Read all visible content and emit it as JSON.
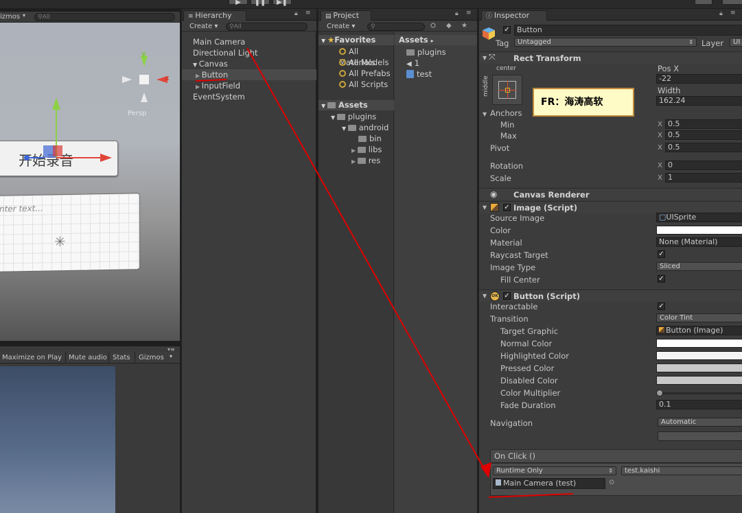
{
  "scene": {
    "gizmos_label": "izmos",
    "search_placeholder": "All",
    "axis_y": "y",
    "axis_x": "x",
    "persp_label": "Persp",
    "button_text": "开始录音",
    "input_placeholder": "nter text..."
  },
  "game": {
    "toolbar": [
      "Maximize on Play",
      "Mute audio",
      "Stats",
      "Gizmos"
    ]
  },
  "hierarchy": {
    "tab": "Hierarchy",
    "create": "Create",
    "search_placeholder": "All",
    "items": [
      "Main Camera",
      "Directional Light",
      "Canvas",
      "Button",
      "InputField",
      "EventSystem"
    ]
  },
  "project": {
    "tab": "Project",
    "create": "Create",
    "favorites_title": "Favorites",
    "favorites": [
      "All Materials",
      "All Models",
      "All Prefabs",
      "All Scripts"
    ],
    "assets_title": "Assets",
    "tree": [
      "plugins",
      "android",
      "bin",
      "libs",
      "res"
    ],
    "breadcrumb": "Assets",
    "assets_items": [
      "plugins",
      "1",
      "test"
    ]
  },
  "inspector": {
    "tab": "Inspector",
    "object_name": "Button",
    "object_active": true,
    "tag_label": "Tag",
    "tag_value": "Untagged",
    "layer_label": "Layer",
    "layer_value": "UI",
    "rect": {
      "title": "Rect Transform",
      "anchor_h": "center",
      "anchor_v": "middle",
      "posx_label": "Pos X",
      "posx_value": "-22",
      "width_label": "Width",
      "width_value": "162.24",
      "anchors_label": "Anchors",
      "min_label": "Min",
      "min_x": "0.5",
      "max_label": "Max",
      "max_x": "0.5",
      "pivot_label": "Pivot",
      "pivot_x": "0.5",
      "rotation_label": "Rotation",
      "rotation_x": "0",
      "scale_label": "Scale",
      "scale_x": "1",
      "x_axis": "X"
    },
    "canvas_renderer": "Canvas Renderer",
    "image": {
      "title": "Image (Script)",
      "enabled": true,
      "source_image_label": "Source Image",
      "source_image_value": "UISprite",
      "color_label": "Color",
      "material_label": "Material",
      "material_value": "None (Material)",
      "raycast_label": "Raycast Target",
      "raycast_checked": true,
      "image_type_label": "Image Type",
      "image_type_value": "Sliced",
      "fill_center_label": "Fill Center",
      "fill_center_checked": true
    },
    "button": {
      "title": "Button (Script)",
      "enabled": true,
      "interactable_label": "Interactable",
      "interactable_checked": true,
      "transition_label": "Transition",
      "transition_value": "Color Tint",
      "target_graphic_label": "Target Graphic",
      "target_graphic_value": "Button (Image)",
      "normal_label": "Normal Color",
      "highlighted_label": "Highlighted Color",
      "pressed_label": "Pressed Color",
      "disabled_label": "Disabled Color",
      "multiplier_label": "Color Multiplier",
      "multiplier_value": 1,
      "fade_label": "Fade Duration",
      "fade_value": "0.1",
      "navigation_label": "Navigation",
      "navigation_value": "Automatic",
      "onclick_label": "On Click ()",
      "runtime_value": "Runtime Only",
      "function_value": "test.kaishi",
      "object_value": "Main Camera (test)"
    },
    "colors": {
      "normal": "#ffffff",
      "highlighted": "#f5f5f5",
      "pressed": "#c8c8c8",
      "disabled": "#c8c8c8"
    }
  },
  "annotation": {
    "label": "FR：海涛高软",
    "arrow_color": "#e00000"
  }
}
